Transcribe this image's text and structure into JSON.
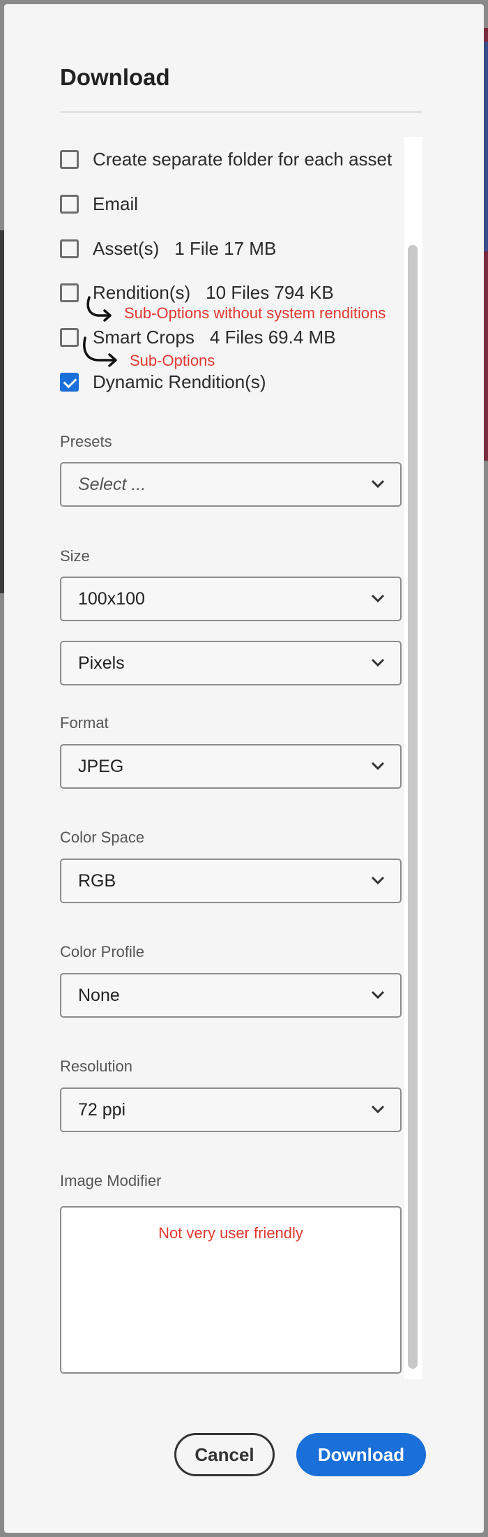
{
  "dialog": {
    "title": "Download"
  },
  "options": [
    {
      "label": "Create separate folder for each asset",
      "meta": "",
      "checked": false
    },
    {
      "label": "Email",
      "meta": "",
      "checked": false
    },
    {
      "label": "Asset(s)",
      "meta": "1 File 17 MB",
      "checked": false
    },
    {
      "label": "Rendition(s)",
      "meta": "10 Files 794 KB",
      "checked": false
    },
    {
      "label": "Smart Crops",
      "meta": "4 Files 69.4 MB",
      "checked": false
    },
    {
      "label": "Dynamic Rendition(s)",
      "meta": "",
      "checked": true
    }
  ],
  "annotations": {
    "renditions_note": "Sub-Options without system renditions",
    "smart_crops_note": "Sub-Options",
    "image_modifier_note": "Not very user friendly",
    "color": "#e2382f"
  },
  "fields": {
    "presets": {
      "label": "Presets",
      "value": "Select ..."
    },
    "size": {
      "label": "Size",
      "value": "100x100"
    },
    "units": {
      "value": "Pixels"
    },
    "format": {
      "label": "Format",
      "value": "JPEG"
    },
    "color_space": {
      "label": "Color Space",
      "value": "RGB"
    },
    "color_profile": {
      "label": "Color Profile",
      "value": "None"
    },
    "resolution": {
      "label": "Resolution",
      "value": "72 ppi"
    },
    "image_modifier": {
      "label": "Image Modifier",
      "value": ""
    }
  },
  "buttons": {
    "cancel": "Cancel",
    "download": "Download"
  },
  "colors": {
    "accent": "#1a6fd8"
  },
  "icons": {
    "chevron": "chevron-down-icon",
    "checkmark": "checkmark-icon"
  }
}
